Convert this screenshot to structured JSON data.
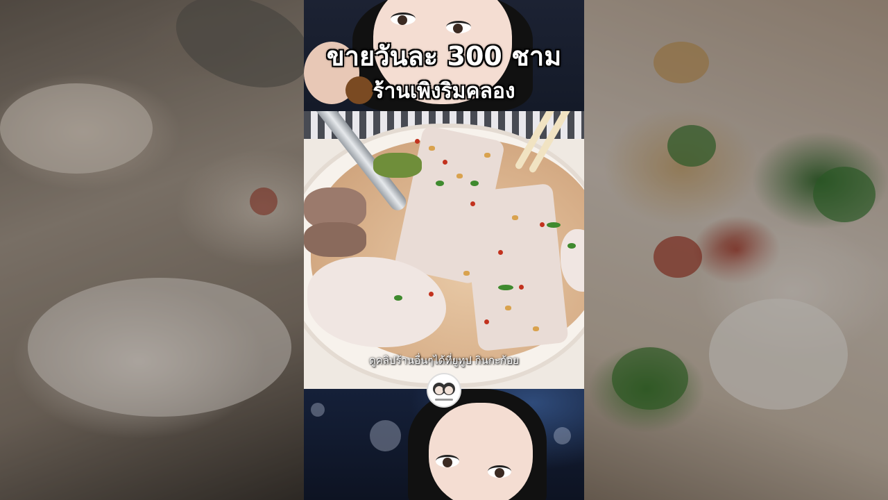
{
  "overlay": {
    "headline_line1": "ขายวันละ 300 ชาม",
    "headline_line2": "ร้านเพิงริมคลอง",
    "caption": "ดูคลิปร้านอื่นๆได้ที่ยูทูป กินกะก้อย"
  },
  "logo": {
    "icon": "channel-logo-two-faces"
  },
  "colors": {
    "headline_text": "#ffffff",
    "background_dark": "#0f1522",
    "chili": "#c2321e",
    "herb": "#3f8a2e"
  }
}
